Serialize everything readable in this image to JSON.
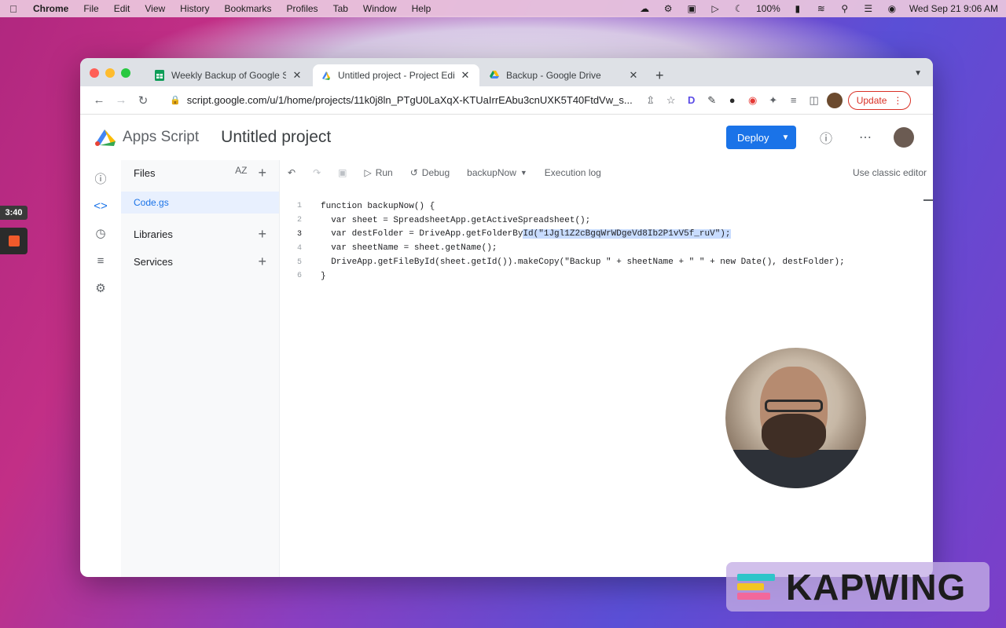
{
  "menubar": {
    "app": "Chrome",
    "items": [
      "File",
      "Edit",
      "View",
      "History",
      "Bookmarks",
      "Profiles",
      "Tab",
      "Window",
      "Help"
    ],
    "battery": "100%",
    "clock": "Wed Sep 21  9:06 AM"
  },
  "recorder": {
    "time": "3:40"
  },
  "tabs": [
    {
      "title": "Weekly Backup of Google She",
      "favicon": "sheets-icon",
      "active": false
    },
    {
      "title": "Untitled project - Project Edito",
      "favicon": "apps-script-icon",
      "active": true
    },
    {
      "title": "Backup - Google Drive",
      "favicon": "drive-icon",
      "active": false
    }
  ],
  "browser": {
    "url": "script.google.com/u/1/home/projects/11k0j8ln_PTgU0LaXqX-KTUaIrrEAbu3cnUXK5T40FtdVw_s...",
    "update_label": "Update"
  },
  "header": {
    "brand": "Apps Script",
    "project": "Untitled project",
    "deploy_label": "Deploy"
  },
  "sidebar": {
    "files_label": "Files",
    "files_sort": "AZ",
    "file": "Code.gs",
    "libraries_label": "Libraries",
    "services_label": "Services"
  },
  "editor_toolbar": {
    "run_label": "Run",
    "debug_label": "Debug",
    "function_select": "backupNow",
    "execution_log_label": "Execution log",
    "classic_editor_label": "Use classic editor"
  },
  "code_lines": [
    {
      "n": "1",
      "text": "function backupNow() {"
    },
    {
      "n": "2",
      "text": "  var sheet = SpreadsheetApp.getActiveSpreadsheet();"
    },
    {
      "n": "3",
      "text": "  var destFolder = DriveApp.getFolderById(\"1Jgl1Z2cBgqWrWDgeVd8Ib2P1vV5f_ruV\");"
    },
    {
      "n": "4",
      "text": "  var sheetName = sheet.getName();"
    },
    {
      "n": "5",
      "text": "  DriveApp.getFileById(sheet.getId()).makeCopy(\"Backup \" + sheetName + \" \" + new Date(), destFolder);"
    },
    {
      "n": "6",
      "text": "}"
    }
  ],
  "watermark": {
    "text": "KAPWING"
  },
  "colors": {
    "accent": "#1a73e8",
    "update_red": "#d93025",
    "kapwing_teal": "#2ec5c9",
    "kapwing_yellow": "#f3c623",
    "kapwing_pink": "#f2689b"
  }
}
